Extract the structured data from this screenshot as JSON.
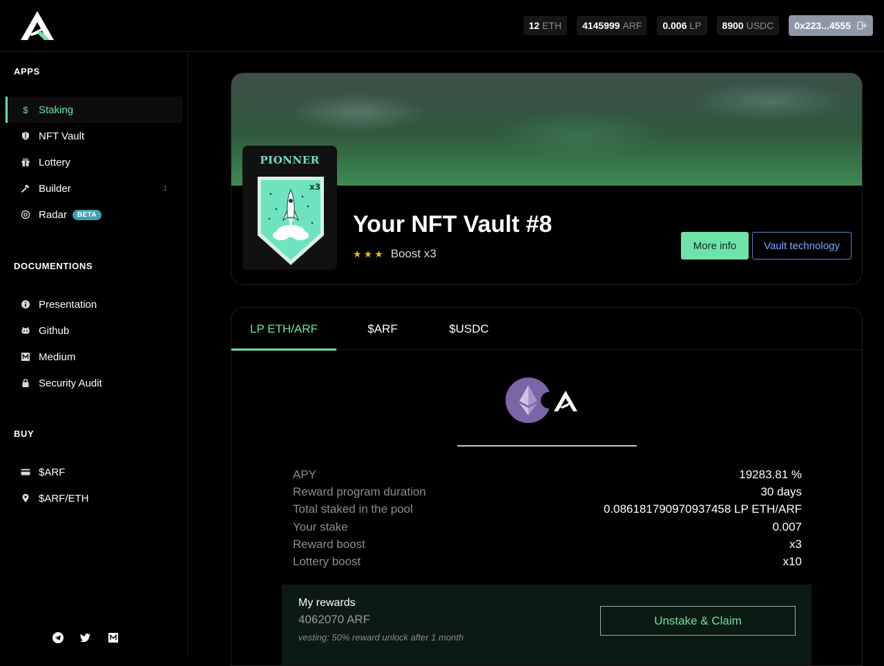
{
  "header": {
    "logo_icon": "arf-logo-icon",
    "balances": [
      {
        "amount": "12",
        "unit": "ETH"
      },
      {
        "amount": "4145999",
        "unit": "ARF"
      },
      {
        "amount": "0.006",
        "unit": "LP"
      },
      {
        "amount": "8900",
        "unit": "USDC"
      }
    ],
    "wallet": {
      "address": "0x223...4555",
      "icon": "logout-icon"
    }
  },
  "sidebar": {
    "apps_title": "APPS",
    "apps": [
      {
        "label": "Staking",
        "icon": "dollar-icon",
        "active": true
      },
      {
        "label": "NFT Vault",
        "icon": "shield-icon"
      },
      {
        "label": "Lottery",
        "icon": "gift-icon"
      },
      {
        "label": "Builder",
        "icon": "hammer-icon",
        "count": "1"
      },
      {
        "label": "Radar",
        "icon": "radar-icon",
        "badge": "BETA"
      }
    ],
    "docs_title": "DOCUMENTIONS",
    "docs": [
      {
        "label": "Presentation",
        "icon": "info-icon"
      },
      {
        "label": "Github",
        "icon": "github-icon"
      },
      {
        "label": "Medium",
        "icon": "medium-icon"
      },
      {
        "label": "Security Audit",
        "icon": "lock-icon"
      }
    ],
    "buy_title": "BUY",
    "buy": [
      {
        "label": "$ARF",
        "icon": "credit-card-icon"
      },
      {
        "label": "$ARF/ETH",
        "icon": "map-pin-icon"
      }
    ],
    "socials": [
      "telegram-icon",
      "twitter-icon",
      "medium-icon"
    ]
  },
  "vault": {
    "nft_title": "PIONNER",
    "nft_multiplier": "x3",
    "name": "Your NFT Vault #8",
    "stars": 3,
    "boost": "Boost x3",
    "more_info": "More info",
    "vault_technology": "Vault technology"
  },
  "pool": {
    "tabs": [
      "LP ETH/ARF",
      "$ARF",
      "$USDC"
    ],
    "active_tab": 0,
    "stats": [
      {
        "label": "APY",
        "value": "19283.81 %"
      },
      {
        "label": "Reward program duration",
        "value": "30 days"
      },
      {
        "label": "Total staked in the pool",
        "value": "0.086181790970937458 LP ETH/ARF"
      },
      {
        "label": "Your stake",
        "value": "0.007"
      },
      {
        "label": "Reward boost",
        "value": "x3"
      },
      {
        "label": "Lottery boost",
        "value": "x10"
      }
    ],
    "rewards": {
      "title": "My rewards",
      "amount": "4062070 ARF",
      "note": "vesting: 50% reward unlock after 1 month",
      "claim_label": "Unstake & Claim"
    }
  },
  "colors": {
    "accent": "#6ee3a8",
    "link": "#7ea6ff",
    "star": "#f0b63a",
    "beta": "#3fa0b8",
    "wallet_bg": "#8e98a8"
  }
}
